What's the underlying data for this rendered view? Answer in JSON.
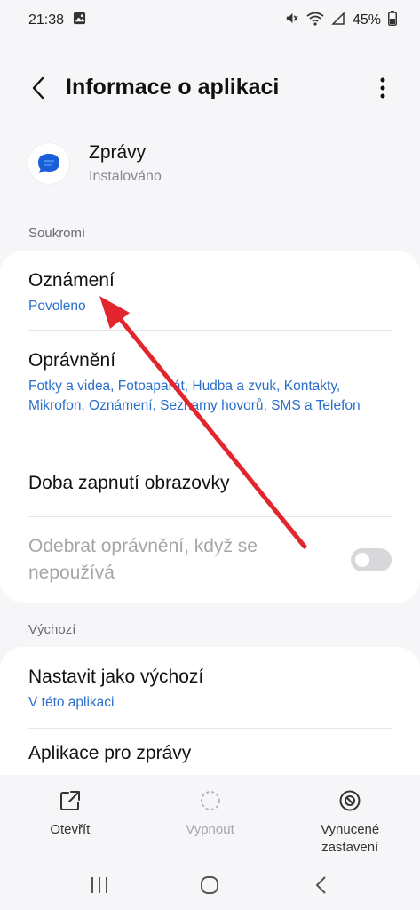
{
  "status_bar": {
    "time": "21:38",
    "battery": "45%"
  },
  "app_bar": {
    "title": "Informace o aplikaci",
    "back_icon": "chevron-left-icon",
    "more_icon": "more-vertical-icon"
  },
  "app": {
    "name": "Zprávy",
    "status": "Instalováno",
    "icon": "messages-bubble-icon",
    "brand_color": "#1a5fd9"
  },
  "sections": {
    "privacy": {
      "label": "Soukromí",
      "items": [
        {
          "title": "Oznámení",
          "subtitle": "Povoleno"
        },
        {
          "title": "Oprávnění",
          "subtitle": "Fotky a videa, Fotoaparát, Hudba a zvuk, Kontakty, Mikrofon, Oznámení, Seznamy hovorů, SMS a Telefon"
        },
        {
          "title": "Doba zapnutí obrazovky"
        },
        {
          "title": "Odebrat oprávnění, když se nepoužívá",
          "toggle_on": false
        }
      ]
    },
    "default": {
      "label": "Výchozí",
      "items": [
        {
          "title": "Nastavit jako výchozí",
          "subtitle": "V této aplikaci"
        },
        {
          "title": "Aplikace pro zprávy"
        }
      ]
    }
  },
  "bottom_actions": [
    {
      "label": "Otevřít",
      "icon": "open-external-icon",
      "enabled": true
    },
    {
      "label": "Vypnout",
      "icon": "disable-circle-icon",
      "enabled": false
    },
    {
      "label": "Vynucené zastavení",
      "icon": "force-stop-icon",
      "enabled": true
    }
  ],
  "colors": {
    "link": "#2a6fc9",
    "annotation_arrow": "#e3262e"
  }
}
